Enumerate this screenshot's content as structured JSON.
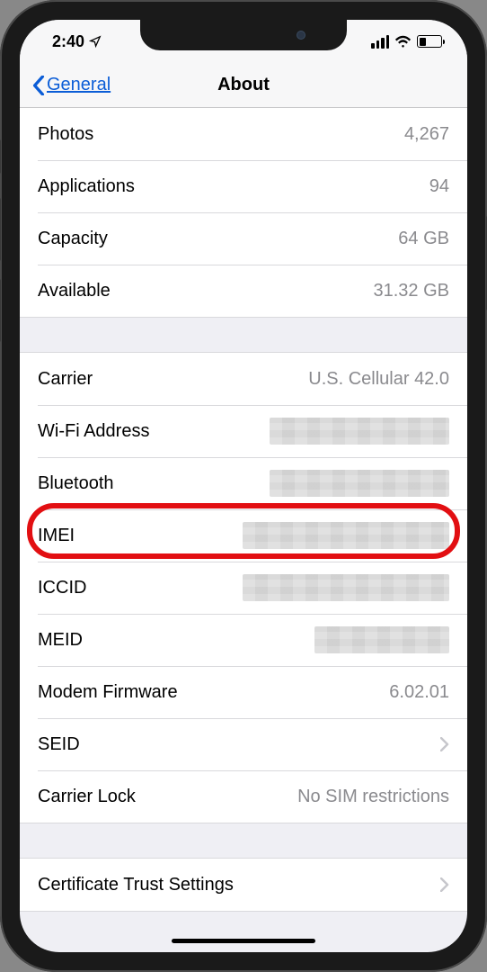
{
  "statusBar": {
    "time": "2:40"
  },
  "nav": {
    "back": "General",
    "title": "About"
  },
  "section1": {
    "rows": [
      {
        "label": "Photos",
        "value": "4,267"
      },
      {
        "label": "Applications",
        "value": "94"
      },
      {
        "label": "Capacity",
        "value": "64 GB"
      },
      {
        "label": "Available",
        "value": "31.32 GB"
      }
    ]
  },
  "section2": {
    "rows": [
      {
        "label": "Carrier",
        "value": "U.S. Cellular 42.0",
        "redacted": false
      },
      {
        "label": "Wi-Fi Address",
        "value": "",
        "redacted": true
      },
      {
        "label": "Bluetooth",
        "value": "",
        "redacted": true
      },
      {
        "label": "IMEI",
        "value": "",
        "redacted": true,
        "highlighted": true
      },
      {
        "label": "ICCID",
        "value": "",
        "redacted": true
      },
      {
        "label": "MEID",
        "value": "",
        "redacted": true
      },
      {
        "label": "Modem Firmware",
        "value": "6.02.01",
        "redacted": false
      },
      {
        "label": "SEID",
        "value": "",
        "disclosure": true
      },
      {
        "label": "Carrier Lock",
        "value": "No SIM restrictions",
        "redacted": false
      }
    ]
  },
  "section3": {
    "rows": [
      {
        "label": "Certificate Trust Settings",
        "value": "",
        "disclosure": true
      }
    ]
  }
}
